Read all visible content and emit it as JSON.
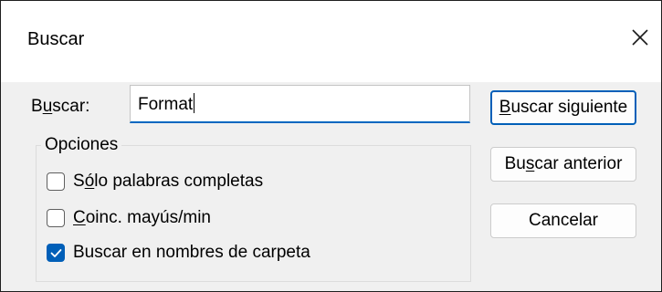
{
  "dialog": {
    "title": "Buscar",
    "close_icon": "close-icon"
  },
  "search": {
    "label_pre": "B",
    "label_u": "u",
    "label_post": "scar:",
    "value": "Format"
  },
  "options": {
    "legend": "Opciones",
    "items": [
      {
        "pre": "S",
        "u": "ó",
        "post": "lo palabras completas",
        "checked": false
      },
      {
        "pre": "",
        "u": "C",
        "post": "oinc. mayús/min",
        "checked": false
      },
      {
        "pre": "",
        "u": "",
        "post": "Buscar en nombres de carpeta",
        "checked": true
      }
    ]
  },
  "buttons": {
    "find_next": {
      "pre": "",
      "u": "B",
      "post": "uscar siguiente"
    },
    "find_prev": {
      "pre": "Bu",
      "u": "s",
      "post": "car anterior"
    },
    "cancel": "Cancelar"
  },
  "colors": {
    "accent": "#005fb8",
    "input_underline": "#0067c0",
    "dialog_bg": "#f0f0f0",
    "titlebar_bg": "#ffffff"
  }
}
